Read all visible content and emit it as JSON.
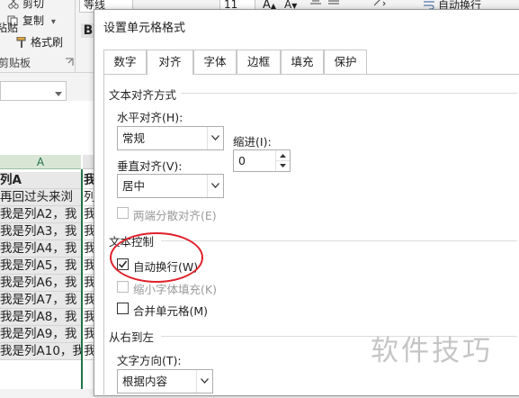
{
  "ribbon": {
    "cut_label": "剪切",
    "copy_label": "复制",
    "copy_dropdown": "▾",
    "paste_label": "粘贴",
    "format_painter_label": "格式刷",
    "clipboard_group": "剪贴板",
    "font_name": "等线",
    "font_size": "11",
    "bold_label": "B",
    "wrap_text_label": "自动换行",
    "name_box_value": ""
  },
  "sheet": {
    "column_header": "A",
    "cells_a": [
      "再回过头来浏",
      "列A",
      "我是列A2，我",
      "我是列A3，我",
      "我是列A4，我",
      "我是列A5，我",
      "我是列A6，我",
      "我是列A7，我",
      "我是列A8，我",
      "我是列A9，我",
      "我是列A10，我"
    ],
    "cells_b": [
      "列",
      "我",
      "我",
      "我",
      "我",
      "我",
      "我",
      "我",
      "我",
      "我",
      "我"
    ]
  },
  "dialog": {
    "title": "设置单元格格式",
    "tabs": [
      "数字",
      "对齐",
      "字体",
      "边框",
      "填充",
      "保护"
    ],
    "active_tab": "对齐",
    "text_alignment": {
      "section_title": "文本对齐方式",
      "horizontal_label": "水平对齐(H):",
      "horizontal_value": "常规",
      "indent_label": "缩进(I):",
      "indent_value": "0",
      "vertical_label": "垂直对齐(V):",
      "vertical_value": "居中",
      "justify_distributed_label": "两端分散对齐(E)"
    },
    "text_control": {
      "section_title": "文本控制",
      "wrap_text_label": "自动换行(W)",
      "wrap_text_checked": true,
      "shrink_to_fit_label": "缩小字体填充(K)",
      "merge_cells_label": "合并单元格(M)"
    },
    "rtl": {
      "section_title": "从右到左",
      "direction_label": "文字方向(T):",
      "direction_value": "根据内容"
    }
  },
  "watermark": "软件技巧",
  "colors": {
    "excel_green": "#217346",
    "annotation_red": "#e0202a"
  }
}
